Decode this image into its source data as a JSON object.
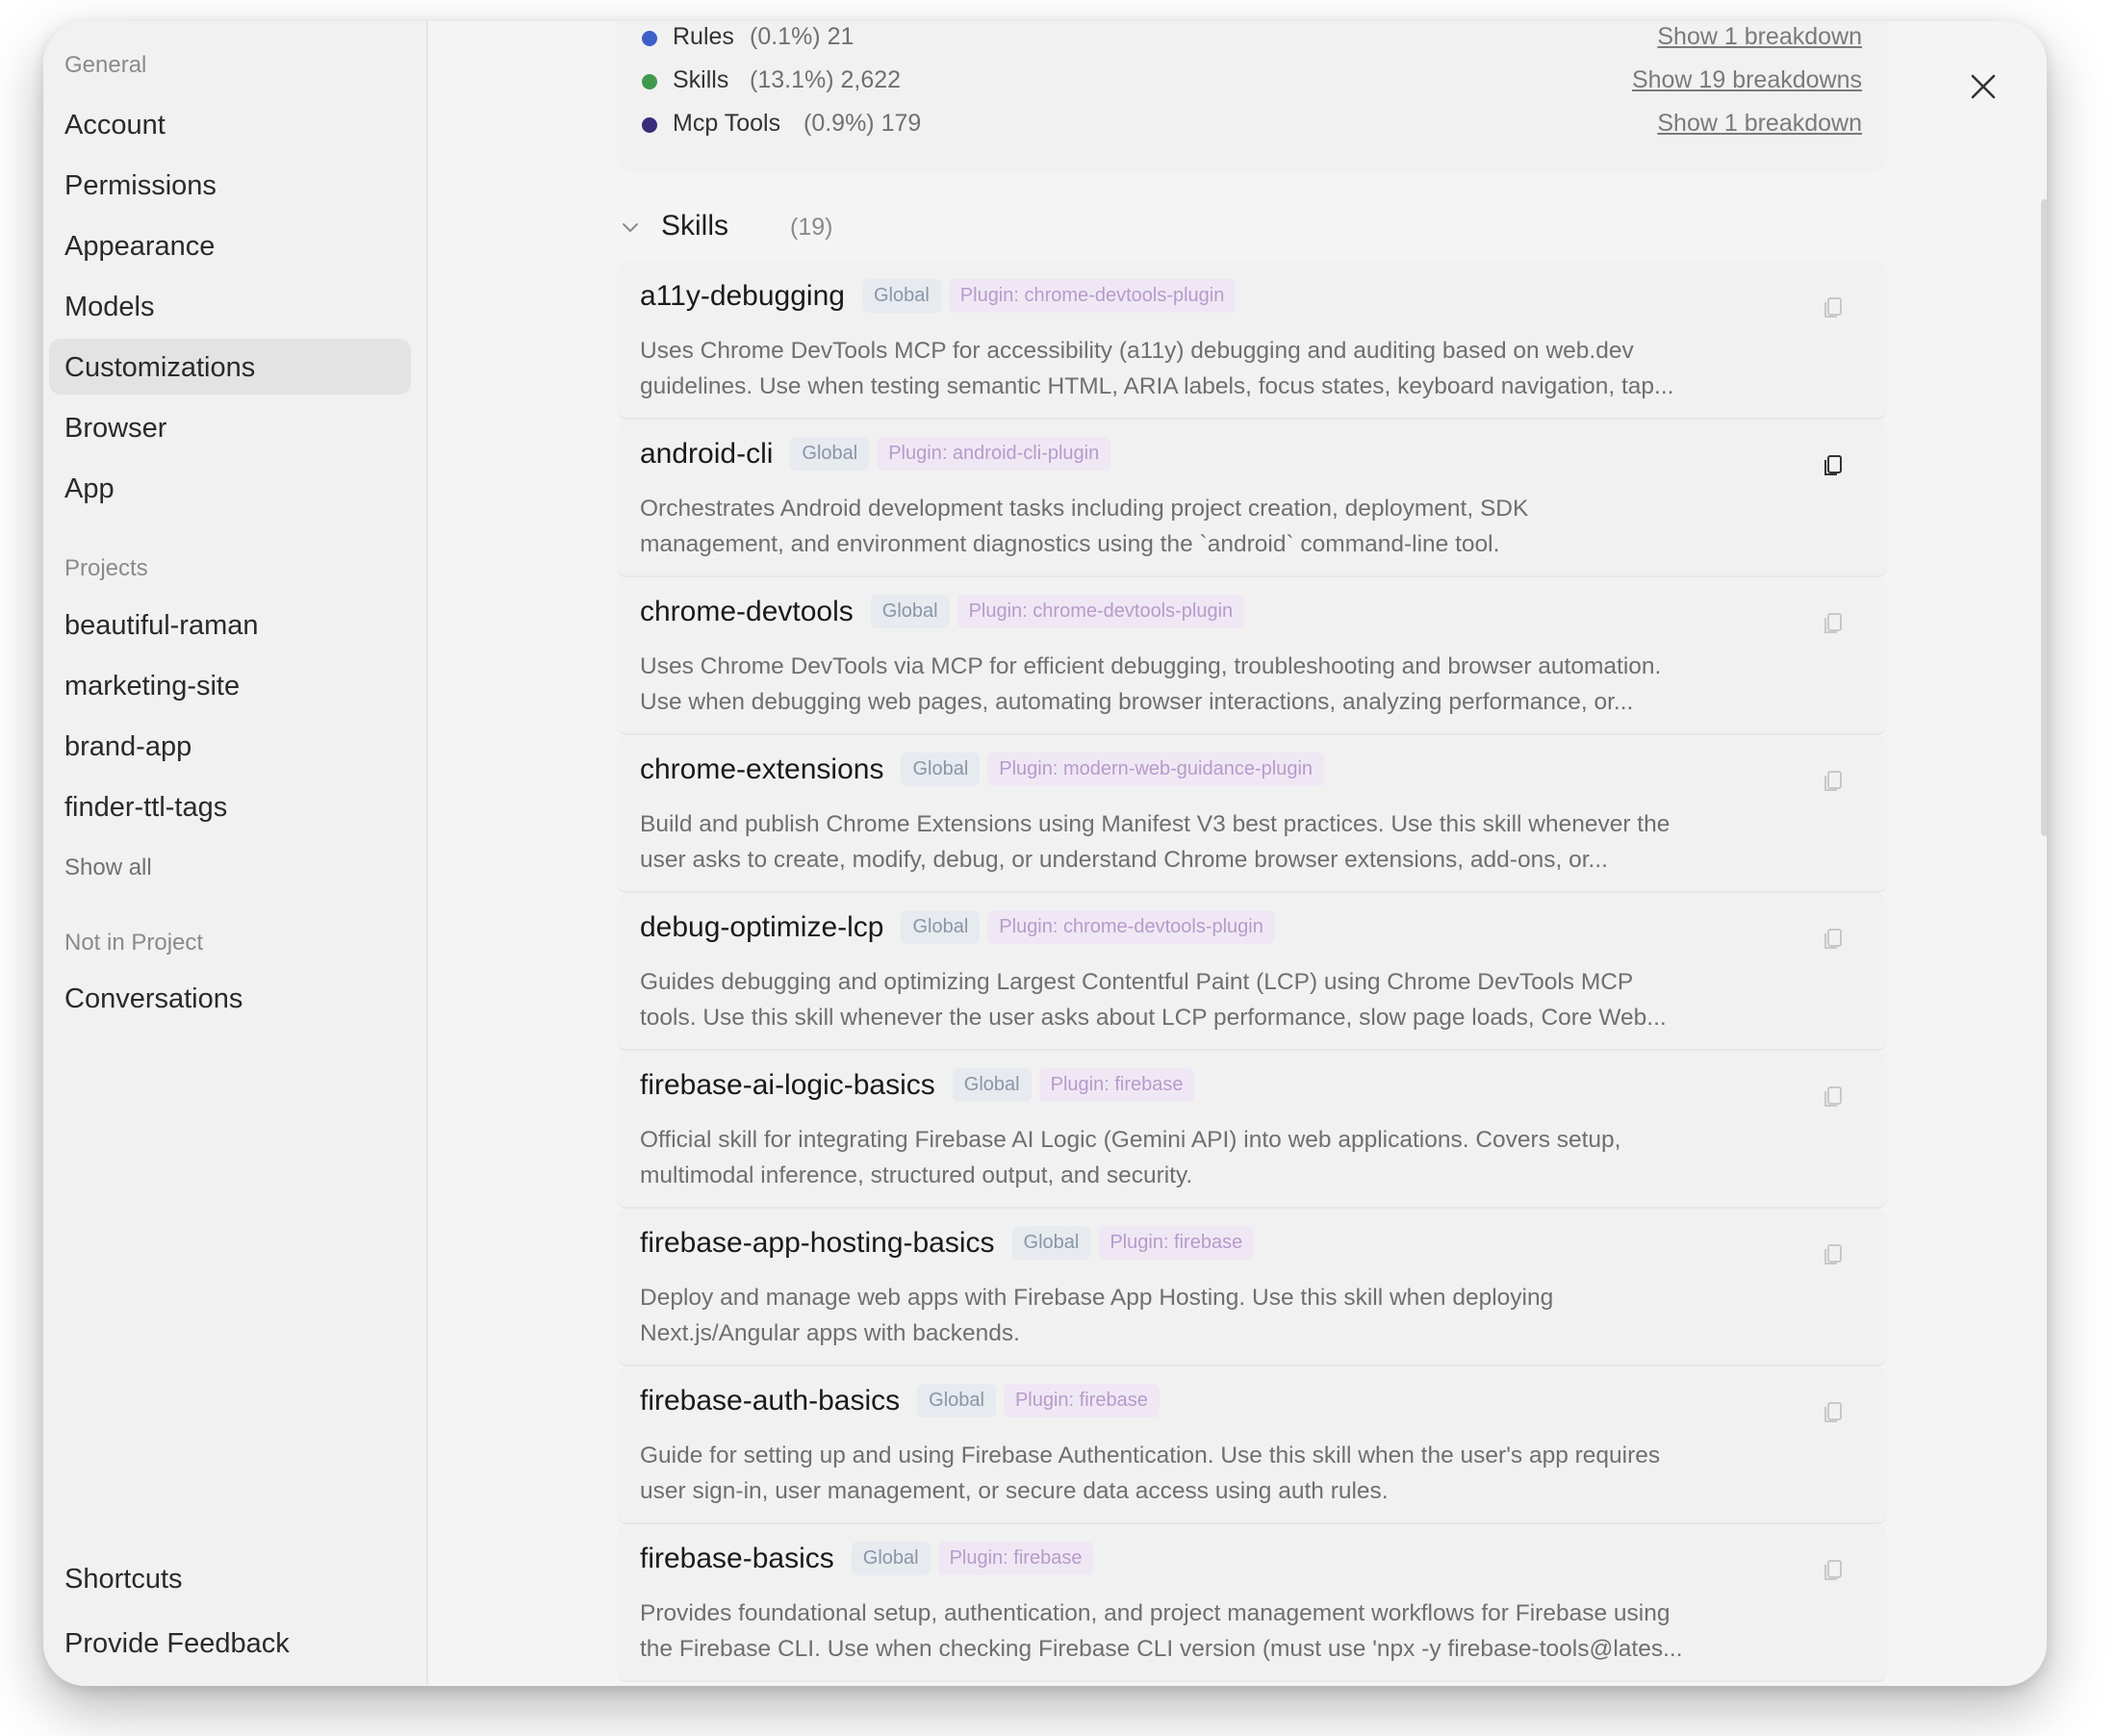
{
  "sidebar": {
    "general_heading": "General",
    "general_items": [
      {
        "label": "Account"
      },
      {
        "label": "Permissions"
      },
      {
        "label": "Appearance"
      },
      {
        "label": "Models"
      },
      {
        "label": "Customizations"
      },
      {
        "label": "Browser"
      },
      {
        "label": "App"
      }
    ],
    "active_item": "Customizations",
    "projects_heading": "Projects",
    "project_items": [
      {
        "label": "beautiful-raman"
      },
      {
        "label": "marketing-site"
      },
      {
        "label": "brand-app"
      },
      {
        "label": "finder-ttl-tags"
      }
    ],
    "show_all": "Show all",
    "not_in_project_heading": "Not in Project",
    "conversations": "Conversations",
    "shortcuts": "Shortcuts",
    "feedback": "Provide Feedback"
  },
  "summary": [
    {
      "name": "Rules",
      "stats": "(0.1%) 21",
      "link": "Show 1 breakdown",
      "color": "#3d5fc9"
    },
    {
      "name": "Skills",
      "stats": "(13.1%) 2,622",
      "link": "Show 19 breakdowns",
      "color": "#3f9a4f"
    },
    {
      "name": "Mcp Tools",
      "stats": "(0.9%) 179",
      "link": "Show 1 breakdown",
      "color": "#3a2c7a"
    }
  ],
  "skills_section": {
    "title": "Skills",
    "count": "(19)"
  },
  "skills": [
    {
      "name": "a11y-debugging",
      "scope": "Global",
      "plugin": "Plugin: chrome-devtools-plugin",
      "desc1": "Uses Chrome DevTools MCP for accessibility (a11y) debugging and auditing based on web.dev",
      "desc2": "guidelines. Use when testing semantic HTML, ARIA labels, focus states, keyboard navigation, tap..."
    },
    {
      "name": "android-cli",
      "scope": "Global",
      "plugin": "Plugin: android-cli-plugin",
      "desc1": "Orchestrates Android development tasks including project creation, deployment, SDK",
      "desc2": "management, and environment diagnostics using the `android` command-line tool."
    },
    {
      "name": "chrome-devtools",
      "scope": "Global",
      "plugin": "Plugin: chrome-devtools-plugin",
      "desc1": "Uses Chrome DevTools via MCP for efficient debugging, troubleshooting and browser automation.",
      "desc2": "Use when debugging web pages, automating browser interactions, analyzing performance, or..."
    },
    {
      "name": "chrome-extensions",
      "scope": "Global",
      "plugin": "Plugin: modern-web-guidance-plugin",
      "desc1": "Build and publish Chrome Extensions using Manifest V3 best practices. Use this skill whenever the",
      "desc2": "user asks to create, modify, debug, or understand Chrome browser extensions, add-ons, or..."
    },
    {
      "name": "debug-optimize-lcp",
      "scope": "Global",
      "plugin": "Plugin: chrome-devtools-plugin",
      "desc1": "Guides debugging and optimizing Largest Contentful Paint (LCP) using Chrome DevTools MCP",
      "desc2": "tools. Use this skill whenever the user asks about LCP performance, slow page loads, Core Web..."
    },
    {
      "name": "firebase-ai-logic-basics",
      "scope": "Global",
      "plugin": "Plugin: firebase",
      "desc1": "Official skill for integrating Firebase AI Logic (Gemini API) into web applications. Covers setup,",
      "desc2": "multimodal inference, structured output, and security."
    },
    {
      "name": "firebase-app-hosting-basics",
      "scope": "Global",
      "plugin": "Plugin: firebase",
      "desc1": "Deploy and manage web apps with Firebase App Hosting. Use this skill when deploying",
      "desc2": "Next.js/Angular apps with backends."
    },
    {
      "name": "firebase-auth-basics",
      "scope": "Global",
      "plugin": "Plugin: firebase",
      "desc1": "Guide for setting up and using Firebase Authentication. Use this skill when the user's app requires",
      "desc2": "user sign-in, user management, or secure data access using auth rules."
    },
    {
      "name": "firebase-basics",
      "scope": "Global",
      "plugin": "Plugin: firebase",
      "desc1": "Provides foundational setup, authentication, and project management workflows for Firebase using",
      "desc2": "the Firebase CLI. Use when checking Firebase CLI version (must use 'npx -y firebase-tools@lates..."
    }
  ]
}
